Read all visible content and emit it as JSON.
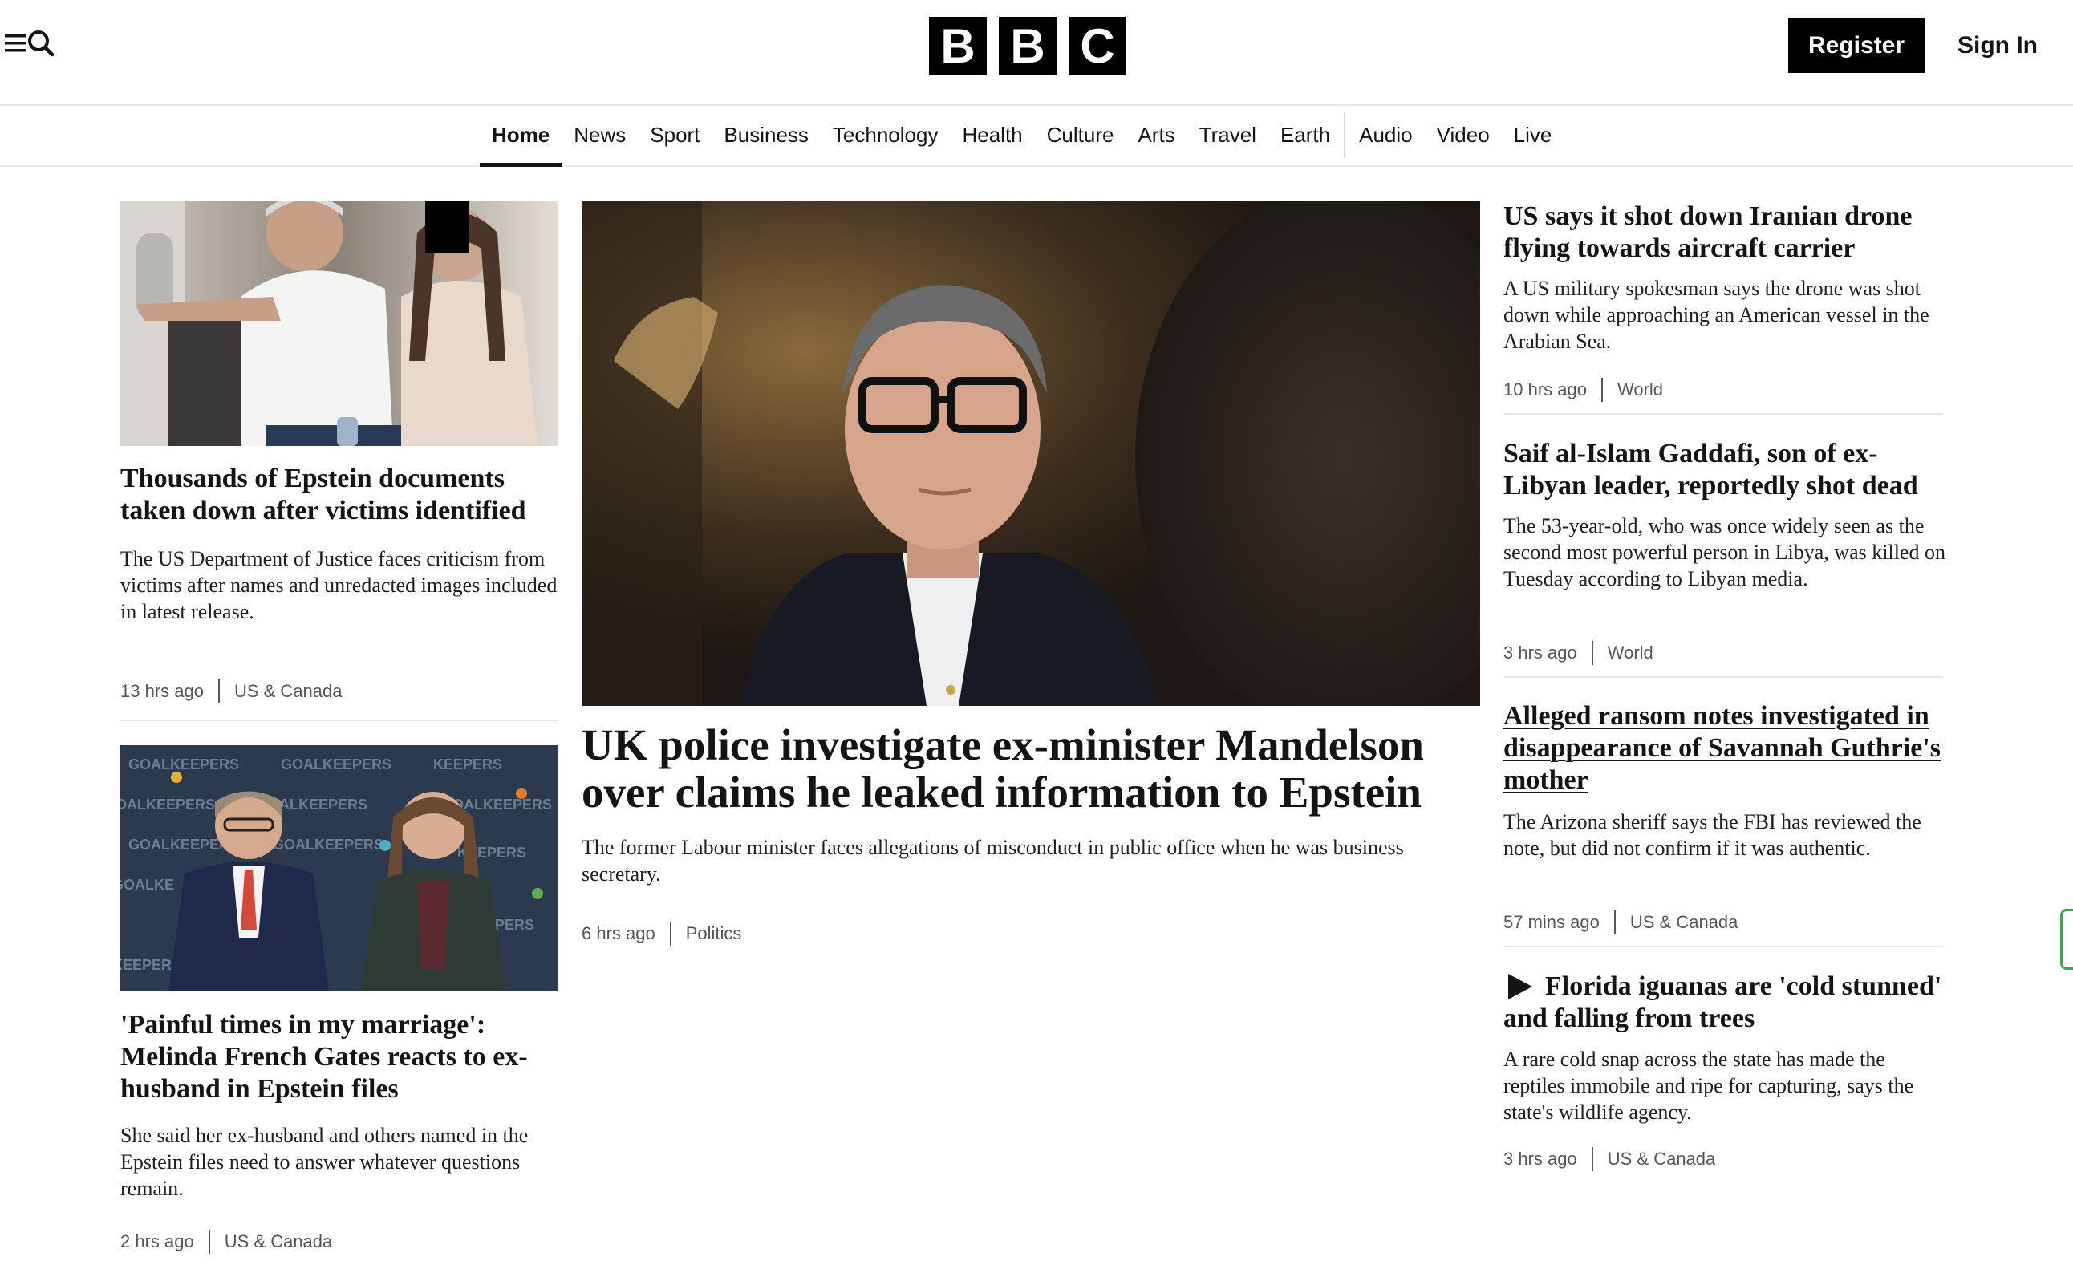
{
  "header": {
    "logo_letters": [
      "B",
      "B",
      "C"
    ],
    "register_label": "Register",
    "signin_label": "Sign In",
    "menu_icon": "hamburger-menu-icon",
    "search_icon": "search-icon"
  },
  "nav": {
    "items": [
      {
        "label": "Home",
        "active": true
      },
      {
        "label": "News"
      },
      {
        "label": "Sport"
      },
      {
        "label": "Business"
      },
      {
        "label": "Technology"
      },
      {
        "label": "Health"
      },
      {
        "label": "Culture"
      },
      {
        "label": "Arts"
      },
      {
        "label": "Travel"
      },
      {
        "label": "Earth"
      },
      {
        "label": "Audio"
      },
      {
        "label": "Video"
      },
      {
        "label": "Live"
      }
    ]
  },
  "left": {
    "stories": [
      {
        "headline": "Thousands of Epstein documents taken down after victims identified",
        "summary": "The US Department of Justice faces criticism from victims after names and unredacted images included in latest release.",
        "time": "13 hrs ago",
        "section": "US & Canada"
      },
      {
        "headline": "'Painful times in my marriage': Melinda French Gates reacts to ex-husband in Epstein files",
        "summary": "She said her ex-husband and others named in the Epstein files need to answer whatever questions remain.",
        "time": "2 hrs ago",
        "section": "US & Canada"
      }
    ]
  },
  "main": {
    "headline": "UK police investigate ex-minister Mandelson over claims he leaked information to Epstein",
    "summary": "The former Labour minister faces allegations of misconduct in public office when he was business secretary.",
    "time": "6 hrs ago",
    "section": "Politics"
  },
  "right": {
    "stories": [
      {
        "headline": "US says it shot down Iranian drone flying towards aircraft carrier",
        "summary": "A US military spokesman says the drone was shot down while approaching an American vessel in the Arabian Sea.",
        "time": "10 hrs ago",
        "section": "World"
      },
      {
        "headline": "Saif al-Islam Gaddafi, son of ex-Libyan leader, reportedly shot dead",
        "summary": "The 53-year-old, who was once widely seen as the second most powerful person in Libya, was killed on Tuesday according to Libyan media.",
        "time": "3 hrs ago",
        "section": "World"
      },
      {
        "headline": "Alleged ransom notes investigated in disappearance of Savannah Guthrie's mother",
        "summary": "The Arizona sheriff says the FBI has reviewed the note, but did not confirm if it was authentic.",
        "time": "57 mins ago",
        "section": "US & Canada"
      },
      {
        "headline": "Florida iguanas are 'cold stunned' and falling from trees",
        "summary": "A rare cold snap across the state has made the reptiles immobile and ripe for capturing, says the state's wildlife agency.",
        "time": "3 hrs ago",
        "section": "US & Canada",
        "video_icon": "play-icon"
      }
    ]
  },
  "gateway_banner": {
    "texts": [
      "GOALKEEPERS",
      "KEEPERS"
    ]
  }
}
